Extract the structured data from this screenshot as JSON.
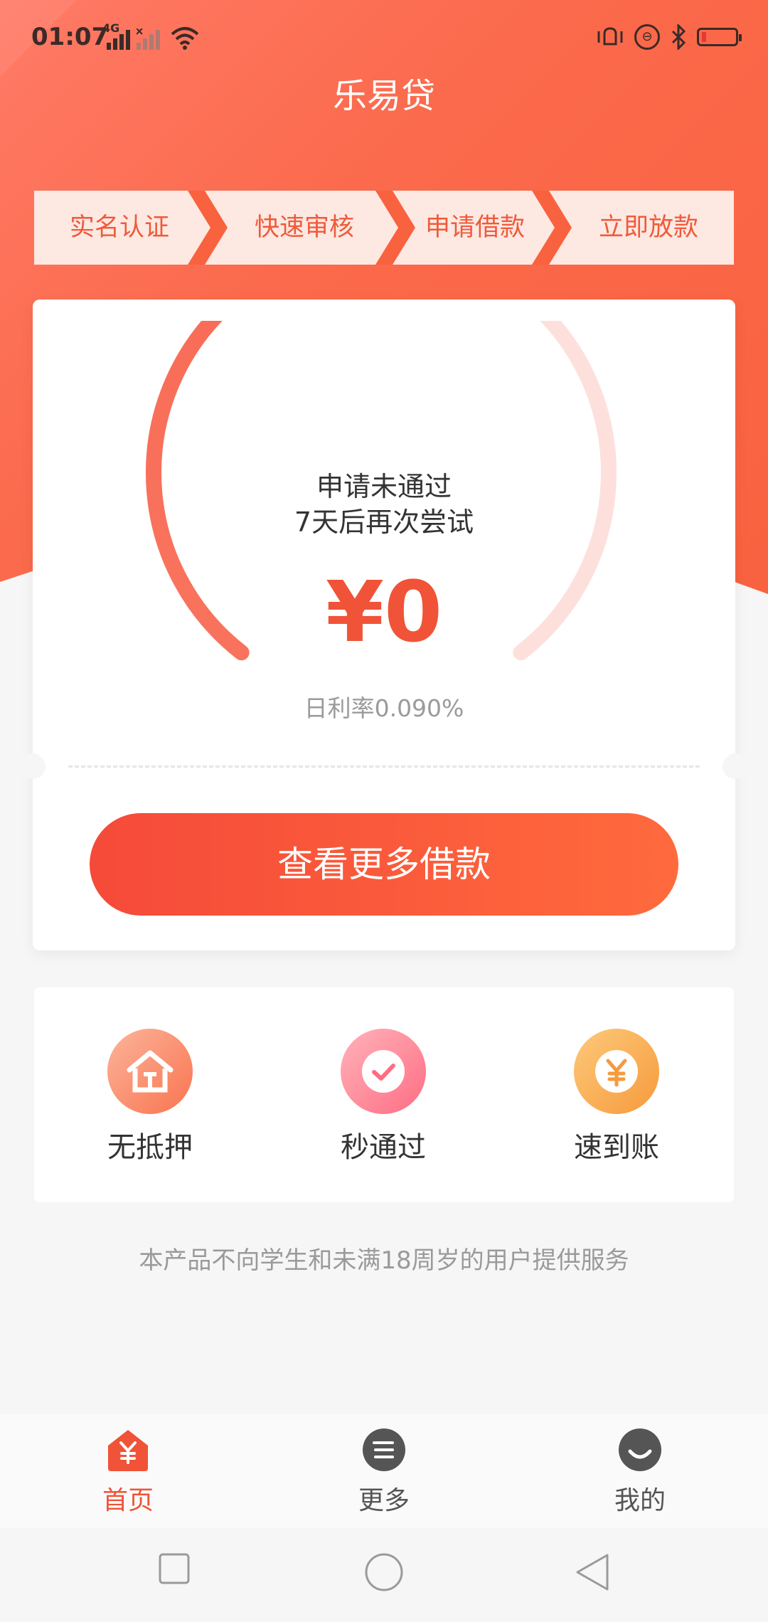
{
  "status_bar": {
    "time": "01:07",
    "network_label": "4G",
    "battery_color": "#e53935"
  },
  "app": {
    "title": "乐易贷"
  },
  "steps": [
    {
      "label": "实名认证"
    },
    {
      "label": "快速审核"
    },
    {
      "label": "申请借款"
    },
    {
      "label": "立即放款"
    }
  ],
  "loan_card": {
    "status_line1": "申请未通过",
    "status_line2": "7天后再次尝试",
    "amount": "¥0",
    "daily_rate": "日利率0.090%",
    "progress_fraction": 0.5,
    "action_button": "查看更多借款"
  },
  "features": [
    {
      "label": "无抵押",
      "icon": "house-icon",
      "color": "#fb8a6b"
    },
    {
      "label": "秒通过",
      "icon": "check-icon",
      "color": "#ff8a96"
    },
    {
      "label": "速到账",
      "icon": "yen-coin-icon",
      "color": "#f8aa52"
    }
  ],
  "notice": "本产品不向学生和未满18周岁的用户提供服务",
  "tab_bar": {
    "items": [
      {
        "label": "首页",
        "icon": "home-yen-icon",
        "active": true
      },
      {
        "label": "更多",
        "icon": "list-icon",
        "active": false
      },
      {
        "label": "我的",
        "icon": "smile-icon",
        "active": false
      }
    ],
    "active_color": "#f05337",
    "inactive_color": "#555555"
  }
}
